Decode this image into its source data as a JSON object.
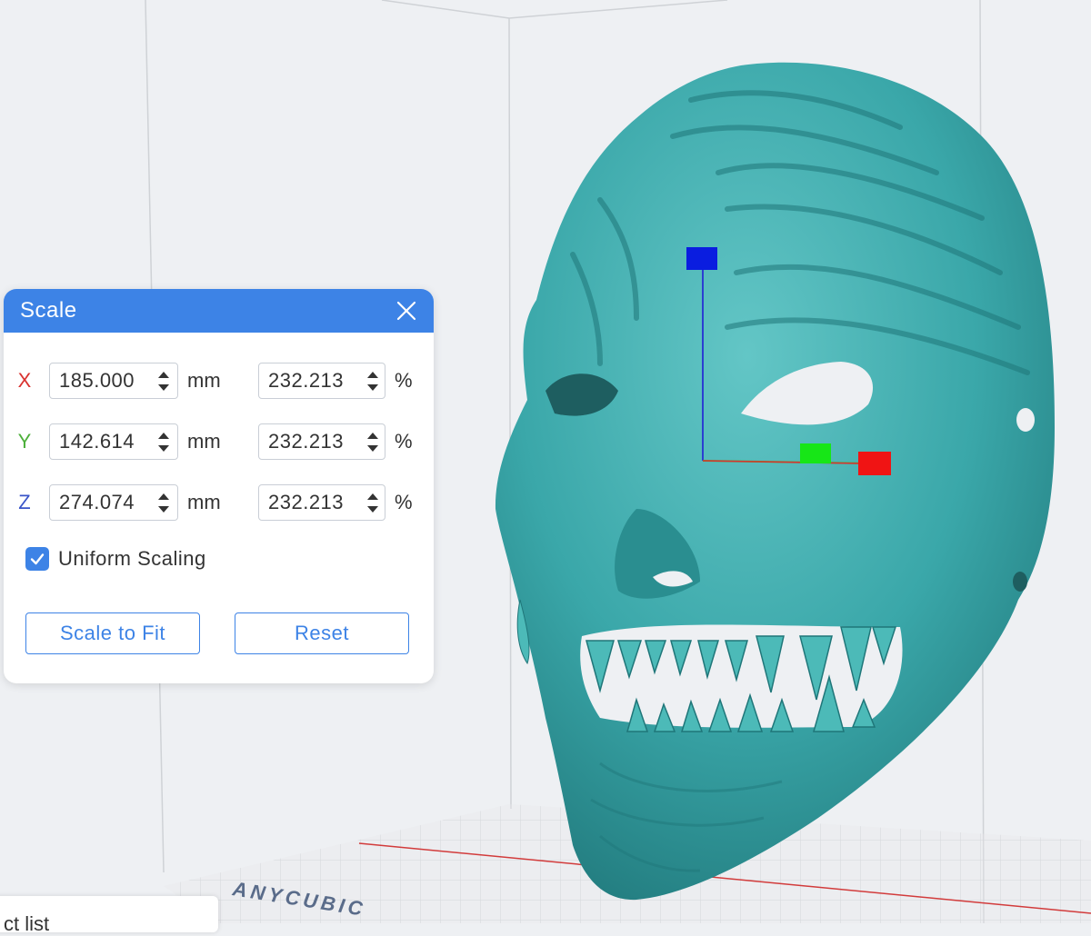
{
  "dialog": {
    "title": "Scale",
    "rows": [
      {
        "axis": "X",
        "axis_color": "#d9322f",
        "mm": "185.000",
        "mm_unit": "mm",
        "percent": "232.213",
        "percent_unit": "%"
      },
      {
        "axis": "Y",
        "axis_color": "#4caf3a",
        "mm": "142.614",
        "mm_unit": "mm",
        "percent": "232.213",
        "percent_unit": "%"
      },
      {
        "axis": "Z",
        "axis_color": "#3a55c8",
        "mm": "274.074",
        "mm_unit": "mm",
        "percent": "232.213",
        "percent_unit": "%"
      }
    ],
    "uniform_scaling_label": "Uniform Scaling",
    "uniform_scaling_checked": true,
    "scale_to_fit_label": "Scale to Fit",
    "reset_label": "Reset"
  },
  "viewport": {
    "bed_logo": "ANYCUBIC",
    "model_color": "#3aa7a9"
  },
  "object_panel": {
    "label": "ct list"
  },
  "colors": {
    "accent": "#3d83e6"
  }
}
